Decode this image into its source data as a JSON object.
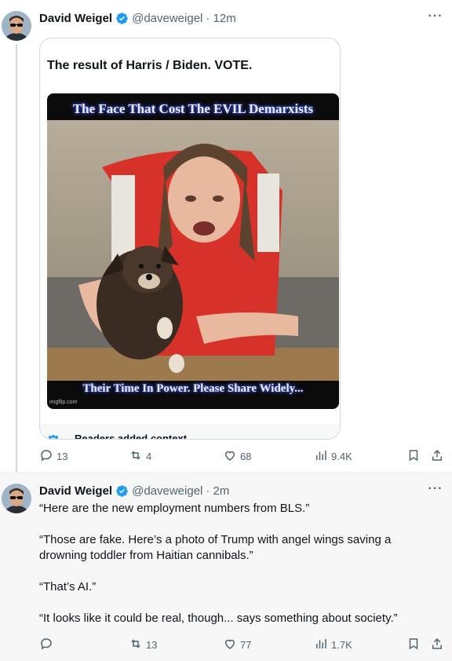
{
  "tweets": [
    {
      "author_name": "David Weigel",
      "handle": "@daveweigel",
      "time": "· 12m",
      "quote": {
        "text": "The result of Harris / Biden.  VOTE.",
        "meme_top": "The Face That Cost The EVIL Demarxists",
        "meme_bottom": "Their Time In Power.  Please Share Widely...",
        "watermark": "imgflip.com",
        "context_label": "Readers added context"
      },
      "actions": {
        "replies": "13",
        "retweets": "4",
        "likes": "68",
        "views": "9.4K"
      }
    },
    {
      "author_name": "David Weigel",
      "handle": "@daveweigel",
      "time": "· 2m",
      "paragraphs": [
        "“Here are the new employment numbers from BLS.”",
        "“Those are fake. Here’s a photo of Trump with angel wings saving a drowning toddler from Haitian cannibals.”",
        "“That’s AI.”",
        "“It looks like it could be real, though... says something about society.”"
      ],
      "actions": {
        "replies": "",
        "retweets": "13",
        "likes": "77",
        "views": "1.7K"
      }
    }
  ],
  "icons": [
    "verified-badge-icon",
    "more-icon",
    "reply-icon",
    "retweet-icon",
    "like-icon",
    "views-icon",
    "bookmark-icon",
    "share-icon",
    "readers-context-icon"
  ],
  "colors": {
    "verified": "#1d9bf0",
    "muted": "#536471",
    "text": "#0f1419"
  }
}
